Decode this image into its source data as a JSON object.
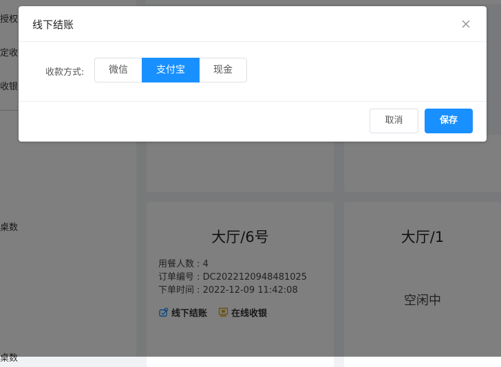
{
  "sidebar": {
    "items": [
      {
        "label": "授权维"
      },
      {
        "label": "定收银"
      },
      {
        "label": "收银"
      },
      {
        "label": "桌数"
      },
      {
        "label": "桌数"
      }
    ]
  },
  "tables": [
    {
      "name": "大厅/6号",
      "diners": "用餐人数 : 4",
      "order_no": "订单编号 : DC2022120948481025",
      "order_time": "下单时间 : 2022-12-09 11:42:08",
      "actions": {
        "offline": "线下结账",
        "online": "在线收银"
      }
    },
    {
      "name": "大厅/1",
      "status": "空闲中"
    }
  ],
  "dialog": {
    "title": "线下结账",
    "pay_label": "收款方式:",
    "pay_options": [
      {
        "label": "微信",
        "selected": false
      },
      {
        "label": "支付宝",
        "selected": true
      },
      {
        "label": "现金",
        "selected": false
      }
    ],
    "cancel_label": "取消",
    "save_label": "保存"
  },
  "colors": {
    "primary": "#1890ff",
    "overlay": "rgba(0,0,0,0.5)"
  },
  "icons": {
    "close": "close-icon",
    "offline_checkout": "checkout-icon",
    "online_cashier": "cashier-icon"
  }
}
